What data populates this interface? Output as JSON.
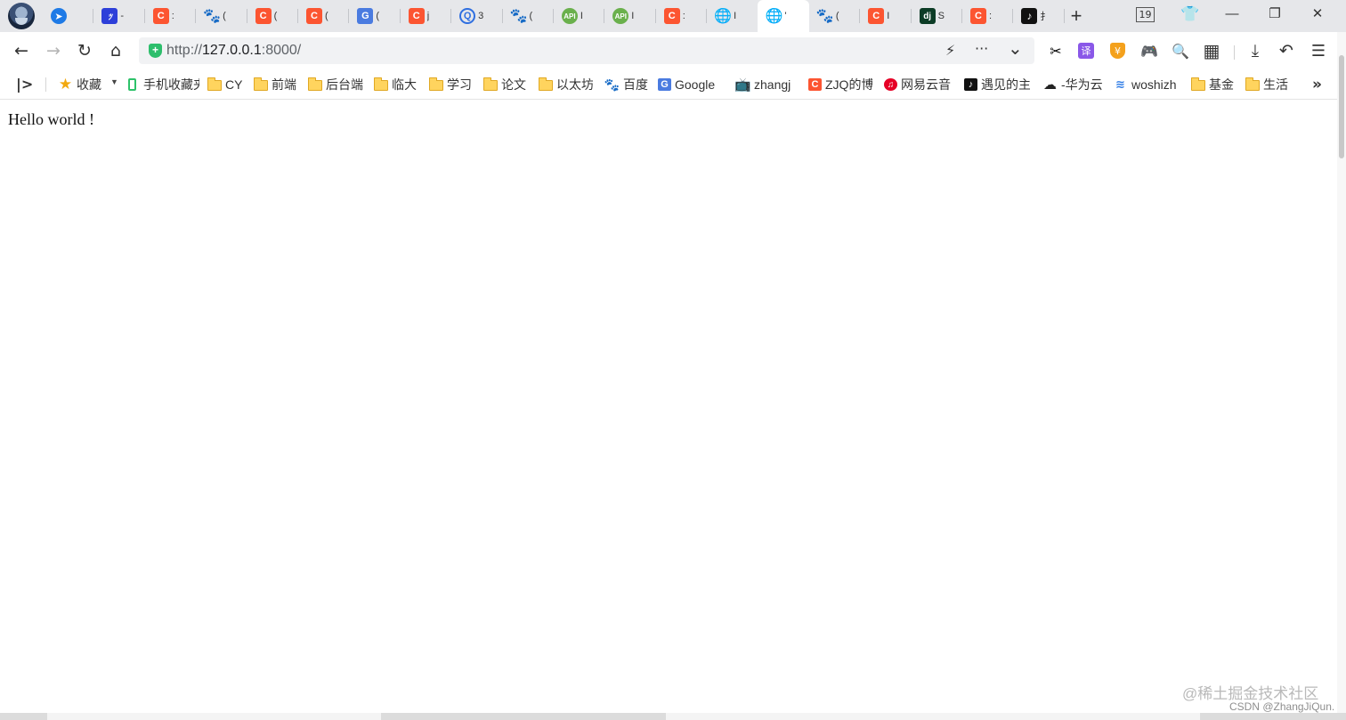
{
  "tabstrip": {
    "tabs": [
      {
        "icon": "telegram-icon",
        "glyph": "➤",
        "cls": "ic-blue-circle",
        "title": ""
      },
      {
        "icon": "site-icon",
        "glyph": "ﾂ",
        "cls": "ic-rect",
        "title": "-"
      },
      {
        "icon": "csdn-icon",
        "glyph": "C",
        "cls": "ic-csdn",
        "title": ":"
      },
      {
        "icon": "baidu-icon",
        "glyph": "🐾",
        "cls": "ic-baidu",
        "title": "("
      },
      {
        "icon": "csdn-icon",
        "glyph": "C",
        "cls": "ic-csdn",
        "title": "("
      },
      {
        "icon": "csdn-icon",
        "glyph": "C",
        "cls": "ic-csdn",
        "title": "("
      },
      {
        "icon": "google-translate-icon",
        "glyph": "G",
        "cls": "ic-google",
        "title": "("
      },
      {
        "icon": "csdn-icon",
        "glyph": "C",
        "cls": "ic-csdn",
        "title": "j"
      },
      {
        "icon": "blue-q-icon",
        "glyph": "Q",
        "cls": "ic-blueq",
        "title": "3"
      },
      {
        "icon": "baidu-icon",
        "glyph": "🐾",
        "cls": "ic-baidu",
        "title": "("
      },
      {
        "icon": "green-api-icon",
        "glyph": "API",
        "cls": "ic-green",
        "title": "I"
      },
      {
        "icon": "green-api-icon",
        "glyph": "API",
        "cls": "ic-green",
        "title": "I"
      },
      {
        "icon": "csdn-icon",
        "glyph": "C",
        "cls": "ic-csdn",
        "title": ":"
      },
      {
        "icon": "globe-icon",
        "glyph": "🌐",
        "cls": "ic-globe",
        "title": "I"
      },
      {
        "icon": "globe-icon",
        "glyph": "🌐",
        "cls": "ic-globe",
        "title": "'",
        "active": true
      },
      {
        "icon": "baidu-icon",
        "glyph": "🐾",
        "cls": "ic-baidu",
        "title": "("
      },
      {
        "icon": "csdn-icon",
        "glyph": "C",
        "cls": "ic-csdn",
        "title": "I"
      },
      {
        "icon": "django-icon",
        "glyph": "dj",
        "cls": "ic-django",
        "title": "S"
      },
      {
        "icon": "csdn-icon",
        "glyph": "C",
        "cls": "ic-csdn",
        "title": ":"
      },
      {
        "icon": "tiktok-icon",
        "glyph": "♪",
        "cls": "ic-tiktok",
        "title": "扌"
      }
    ],
    "new_tab": "+",
    "tab_count": "19",
    "minimize": "—",
    "restore": "❐",
    "close": "✕"
  },
  "toolbar": {
    "back": "←",
    "forward": "→",
    "reload": "↻",
    "home": "⌂",
    "url_prefix": "http://",
    "url_host": "127.0.0.1",
    "url_suffix": ":8000/",
    "secure_glyph": "+",
    "flash": "⚡",
    "more": "···",
    "dropdown": "⌄",
    "cut": "✂",
    "translate": "译",
    "shield": "¥",
    "game": "🎮",
    "search": "🔍",
    "apps": "▦",
    "download": "⤓",
    "undo": "↶",
    "menu": "☰"
  },
  "bookmarks": {
    "toggle": "|>",
    "items": [
      {
        "label": "收藏",
        "type": "star"
      },
      {
        "label": "手机收藏夹",
        "type": "phone"
      },
      {
        "label": "CY",
        "type": "folder"
      },
      {
        "label": "前端",
        "type": "folder"
      },
      {
        "label": "后台端",
        "type": "folder"
      },
      {
        "label": "临大",
        "type": "folder"
      },
      {
        "label": "学习",
        "type": "folder"
      },
      {
        "label": "论文",
        "type": "folder"
      },
      {
        "label": "以太坊",
        "type": "folder"
      },
      {
        "label": "百度",
        "type": "baidu"
      },
      {
        "label": "Google",
        "type": "google"
      },
      {
        "label": "zhangj",
        "type": "bilibili"
      },
      {
        "label": "ZJQ的博",
        "type": "csdn"
      },
      {
        "label": "网易云音",
        "type": "netease"
      },
      {
        "label": "遇见的主",
        "type": "tiktok"
      },
      {
        "label": "-华为云",
        "type": "huawei"
      },
      {
        "label": "woshizh",
        "type": "woshizhu"
      },
      {
        "label": "基金",
        "type": "folder"
      },
      {
        "label": "生活",
        "type": "folder"
      }
    ],
    "more": "»"
  },
  "page": {
    "body_text": "Hello world !"
  },
  "watermark": {
    "line1": "@稀土掘金技术社区",
    "line2": "CSDN @ZhangJiQun."
  }
}
